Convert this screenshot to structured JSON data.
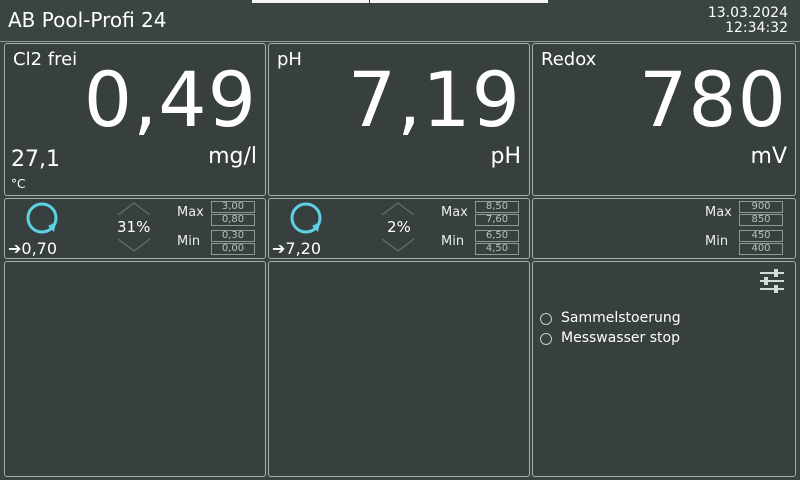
{
  "header": {
    "title": "AB Pool-Profi 24",
    "date": "13.03.2024",
    "time": "12:34:32"
  },
  "measurements": [
    {
      "label": "Cl2 frei",
      "value": "0,49",
      "unit": "mg/l",
      "temp_value": "27,1",
      "temp_unit": "°C"
    },
    {
      "label": "pH",
      "value": "7,19",
      "unit": "pH"
    },
    {
      "label": "Redox",
      "value": "780",
      "unit": "mV"
    }
  ],
  "controls": [
    {
      "setpoint": "➔0,70",
      "percent": "31%",
      "max_label": "Max",
      "min_label": "Min",
      "max_values": [
        "3,00",
        "0,80"
      ],
      "min_values": [
        "0,30",
        "0,00"
      ]
    },
    {
      "setpoint": "➔7,20",
      "percent": "2%",
      "max_label": "Max",
      "min_label": "Min",
      "max_values": [
        "8,50",
        "7,60"
      ],
      "min_values": [
        "6,50",
        "4,50"
      ]
    },
    {
      "max_label": "Max",
      "min_label": "Min",
      "max_values": [
        "900",
        "850"
      ],
      "min_values": [
        "450",
        "400"
      ]
    }
  ],
  "status": {
    "items": [
      {
        "label": "Sammelstoerung"
      },
      {
        "label": "Messwasser stop"
      }
    ]
  },
  "colors": {
    "accent": "#5ed2e4",
    "background": "#3a4442",
    "panel_border": "#a4adab"
  },
  "icons": {
    "settings": "sliders-icon",
    "arrow": "right-arrow"
  }
}
